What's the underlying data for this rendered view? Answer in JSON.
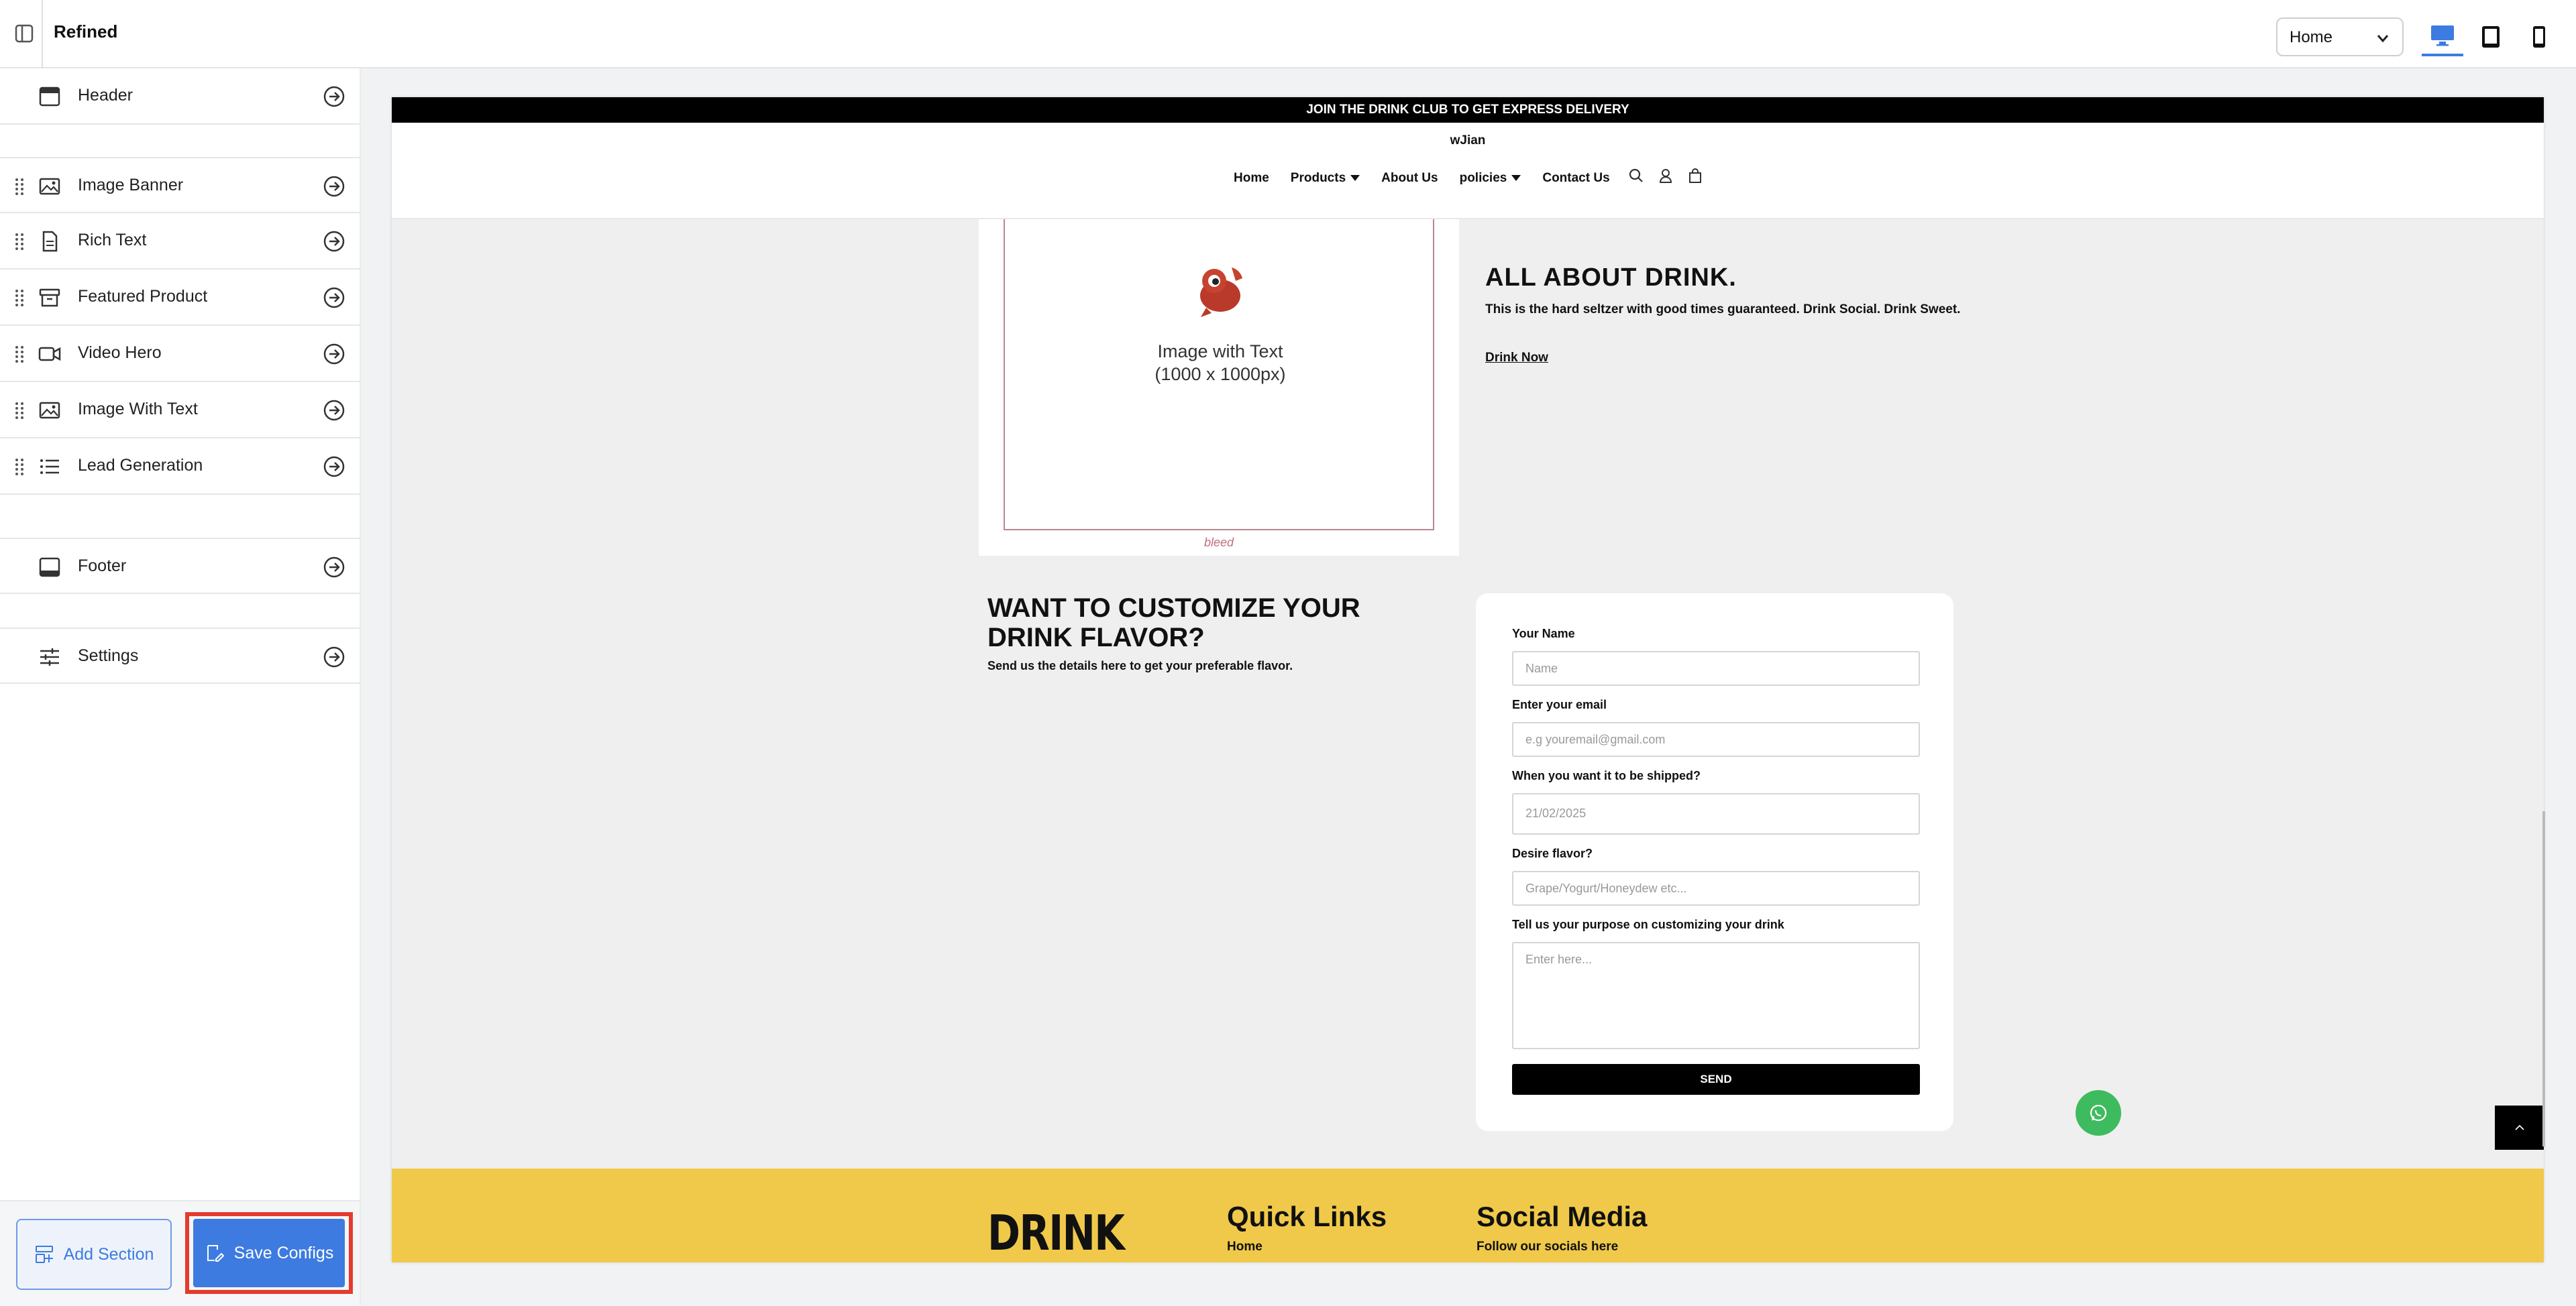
{
  "app": {
    "title": "Refined"
  },
  "topbar": {
    "page_select": "Home"
  },
  "sidebar": {
    "header": "Header",
    "sections": [
      "Image Banner",
      "Rich Text",
      "Featured Product",
      "Video Hero",
      "Image With Text",
      "Lead Generation"
    ],
    "footer": "Footer",
    "settings": "Settings",
    "add_section": "Add Section",
    "save_configs": "Save Configs"
  },
  "preview": {
    "announcement": "JOIN THE DRINK CLUB TO GET EXPRESS DELIVERY",
    "store_name": "wJian",
    "nav": {
      "home": "Home",
      "products": "Products",
      "about": "About Us",
      "policies": "policies",
      "contact": "Contact Us"
    },
    "image_placeholder": {
      "line1": "Image with Text",
      "line2": "(1000 x 1000px)",
      "caption": "bleed"
    },
    "about": {
      "title": "ALL ABOUT DRINK.",
      "text": "This is the hard seltzer with good times guaranteed. Drink Social. Drink Sweet.",
      "link": "Drink Now"
    },
    "customize": {
      "title": "WANT TO CUSTOMIZE YOUR DRINK FLAVOR?",
      "text": "Send us the details here to get your preferable flavor."
    },
    "form": {
      "name_label": "Your Name",
      "name_placeholder": "Name",
      "email_label": "Enter your email",
      "email_placeholder": "e.g youremail@gmail.com",
      "date_label": "When you want it to be shipped?",
      "date_value": "21/02/2025",
      "flavor_label": "Desire flavor?",
      "flavor_placeholder": "Grape/Yogurt/Honeydew etc...",
      "purpose_label": "Tell us your purpose on customizing your drink",
      "purpose_placeholder": "Enter here...",
      "send": "SEND"
    },
    "footer": {
      "logo": "DRINK",
      "quick_links": "Quick Links",
      "home": "Home",
      "social": "Social Media",
      "follow": "Follow our socials here"
    }
  }
}
